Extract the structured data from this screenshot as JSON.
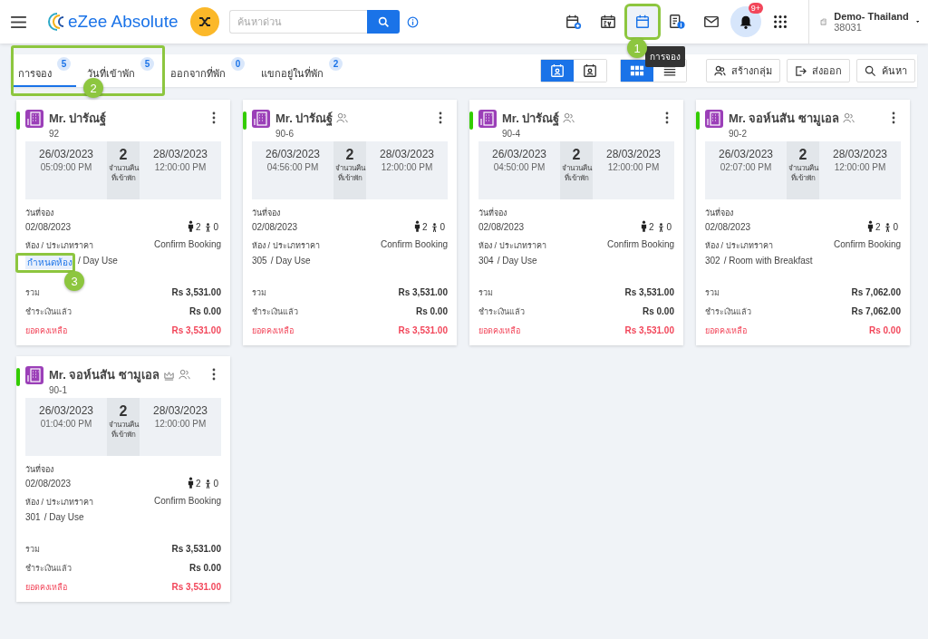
{
  "header": {
    "logo_text": "eZee Absolute",
    "search": {
      "placeholder": "ค้นหาด่วน"
    },
    "icons": [
      {
        "kind": "calendar-plus",
        "selected": false
      },
      {
        "kind": "calendar-list",
        "selected": false
      },
      {
        "kind": "calendar",
        "selected": true,
        "callout": "1"
      },
      {
        "kind": "invoice",
        "selected": false
      },
      {
        "kind": "mail",
        "selected": false
      },
      {
        "kind": "bell",
        "selected": false,
        "badge": "9+"
      },
      {
        "kind": "apps",
        "selected": false
      }
    ],
    "tooltip": "การจอง",
    "property": {
      "name": "Demo- Thailand",
      "code": "38031"
    }
  },
  "tabs_callout": "2",
  "tabs": [
    {
      "label": "การจอง",
      "count": "5",
      "selected": true
    },
    {
      "label": "วันที่เข้าพัก",
      "count": "5",
      "selected": false
    },
    {
      "label": "ออกจากที่พัก",
      "count": "0",
      "selected": false
    },
    {
      "label": "แขกอยู่ในที่พัก",
      "count": "2",
      "selected": false
    }
  ],
  "view_toggles": [
    [
      {
        "kind": "guest",
        "selected": true
      },
      {
        "kind": "guest-list",
        "selected": false
      }
    ],
    [
      {
        "kind": "grid",
        "selected": true
      },
      {
        "kind": "list",
        "selected": false
      }
    ]
  ],
  "actions": [
    {
      "kind": "group",
      "label": "สร้างกลุ่ม"
    },
    {
      "kind": "export",
      "label": "ส่งออก"
    },
    {
      "kind": "search",
      "label": "ค้นหา"
    }
  ],
  "cards": [
    {
      "name": "Mr. ปารัณฐ์",
      "number": "92",
      "group": false,
      "vip": false,
      "arrival_date": "26/03/2023",
      "arrival_time": "05:09:00 PM",
      "nights": "2",
      "nights_label": "จำนวนคืนที่เข้าพัก",
      "departure_date": "28/03/2023",
      "departure_time": "12:00:00 PM",
      "booking_label": "วันที่จอง",
      "booking_date": "02/08/2023",
      "adults": "2",
      "children": "0",
      "room_label": "ห้อง / ประเภทราคา",
      "status": "Confirm Booking",
      "room": "กำหนดห้อง",
      "room_assigned": false,
      "rate": "/ Day Use",
      "room_callout": "3",
      "totals": [
        {
          "kind": "total",
          "label": "รวม",
          "value": "Rs 3,531.00"
        },
        {
          "kind": "paid",
          "label": "ชำระเงินแล้ว",
          "value": "Rs 0.00"
        },
        {
          "kind": "balance",
          "label": "ยอดคงเหลือ",
          "value": "Rs 3,531.00"
        }
      ]
    },
    {
      "name": "Mr. ปารัณฐ์",
      "number": "90-6",
      "group": true,
      "vip": false,
      "arrival_date": "26/03/2023",
      "arrival_time": "04:56:00 PM",
      "nights": "2",
      "nights_label": "จำนวนคืนที่เข้าพัก",
      "departure_date": "28/03/2023",
      "departure_time": "12:00:00 PM",
      "booking_label": "วันที่จอง",
      "booking_date": "02/08/2023",
      "adults": "2",
      "children": "0",
      "room_label": "ห้อง / ประเภทราคา",
      "status": "Confirm Booking",
      "room": "305",
      "room_assigned": true,
      "rate": "/ Day Use",
      "totals": [
        {
          "kind": "total",
          "label": "รวม",
          "value": "Rs 3,531.00"
        },
        {
          "kind": "paid",
          "label": "ชำระเงินแล้ว",
          "value": "Rs 0.00"
        },
        {
          "kind": "balance",
          "label": "ยอดคงเหลือ",
          "value": "Rs 3,531.00"
        }
      ]
    },
    {
      "name": "Mr. ปารัณฐ์",
      "number": "90-4",
      "group": true,
      "vip": false,
      "arrival_date": "26/03/2023",
      "arrival_time": "04:50:00 PM",
      "nights": "2",
      "nights_label": "จำนวนคืนที่เข้าพัก",
      "departure_date": "28/03/2023",
      "departure_time": "12:00:00 PM",
      "booking_label": "วันที่จอง",
      "booking_date": "02/08/2023",
      "adults": "2",
      "children": "0",
      "room_label": "ห้อง / ประเภทราคา",
      "status": "Confirm Booking",
      "room": "304",
      "room_assigned": true,
      "rate": "/ Day Use",
      "totals": [
        {
          "kind": "total",
          "label": "รวม",
          "value": "Rs 3,531.00"
        },
        {
          "kind": "paid",
          "label": "ชำระเงินแล้ว",
          "value": "Rs 0.00"
        },
        {
          "kind": "balance",
          "label": "ยอดคงเหลือ",
          "value": "Rs 3,531.00"
        }
      ]
    },
    {
      "name": "Mr. จอห์นสัน ซามูเอล",
      "number": "90-2",
      "group": true,
      "vip": false,
      "arrival_date": "26/03/2023",
      "arrival_time": "02:07:00 PM",
      "nights": "2",
      "nights_label": "จำนวนคืนที่เข้าพัก",
      "departure_date": "28/03/2023",
      "departure_time": "12:00:00 PM",
      "booking_label": "วันที่จอง",
      "booking_date": "02/08/2023",
      "adults": "2",
      "children": "0",
      "room_label": "ห้อง / ประเภทราคา",
      "status": "Confirm Booking",
      "room": "302",
      "room_assigned": true,
      "rate": "/ Room with Breakfast",
      "totals": [
        {
          "kind": "total",
          "label": "รวม",
          "value": "Rs 7,062.00"
        },
        {
          "kind": "paid",
          "label": "ชำระเงินแล้ว",
          "value": "Rs 7,062.00"
        },
        {
          "kind": "balance",
          "label": "ยอดคงเหลือ",
          "value": "Rs 0.00"
        }
      ]
    },
    {
      "name": "Mr. จอห์นสัน ซามูเอล",
      "number": "90-1",
      "group": true,
      "vip": true,
      "arrival_date": "26/03/2023",
      "arrival_time": "01:04:00 PM",
      "nights": "2",
      "nights_label": "จำนวนคืนที่เข้าพัก",
      "departure_date": "28/03/2023",
      "departure_time": "12:00:00 PM",
      "booking_label": "วันที่จอง",
      "booking_date": "02/08/2023",
      "adults": "2",
      "children": "0",
      "room_label": "ห้อง / ประเภทราคา",
      "status": "Confirm Booking",
      "room": "301",
      "room_assigned": true,
      "rate": "/ Day Use",
      "totals": [
        {
          "kind": "total",
          "label": "รวม",
          "value": "Rs 3,531.00"
        },
        {
          "kind": "paid",
          "label": "ชำระเงินแล้ว",
          "value": "Rs 0.00"
        },
        {
          "kind": "balance",
          "label": "ยอดคงเหลือ",
          "value": "Rs 3,531.00"
        }
      ]
    }
  ]
}
